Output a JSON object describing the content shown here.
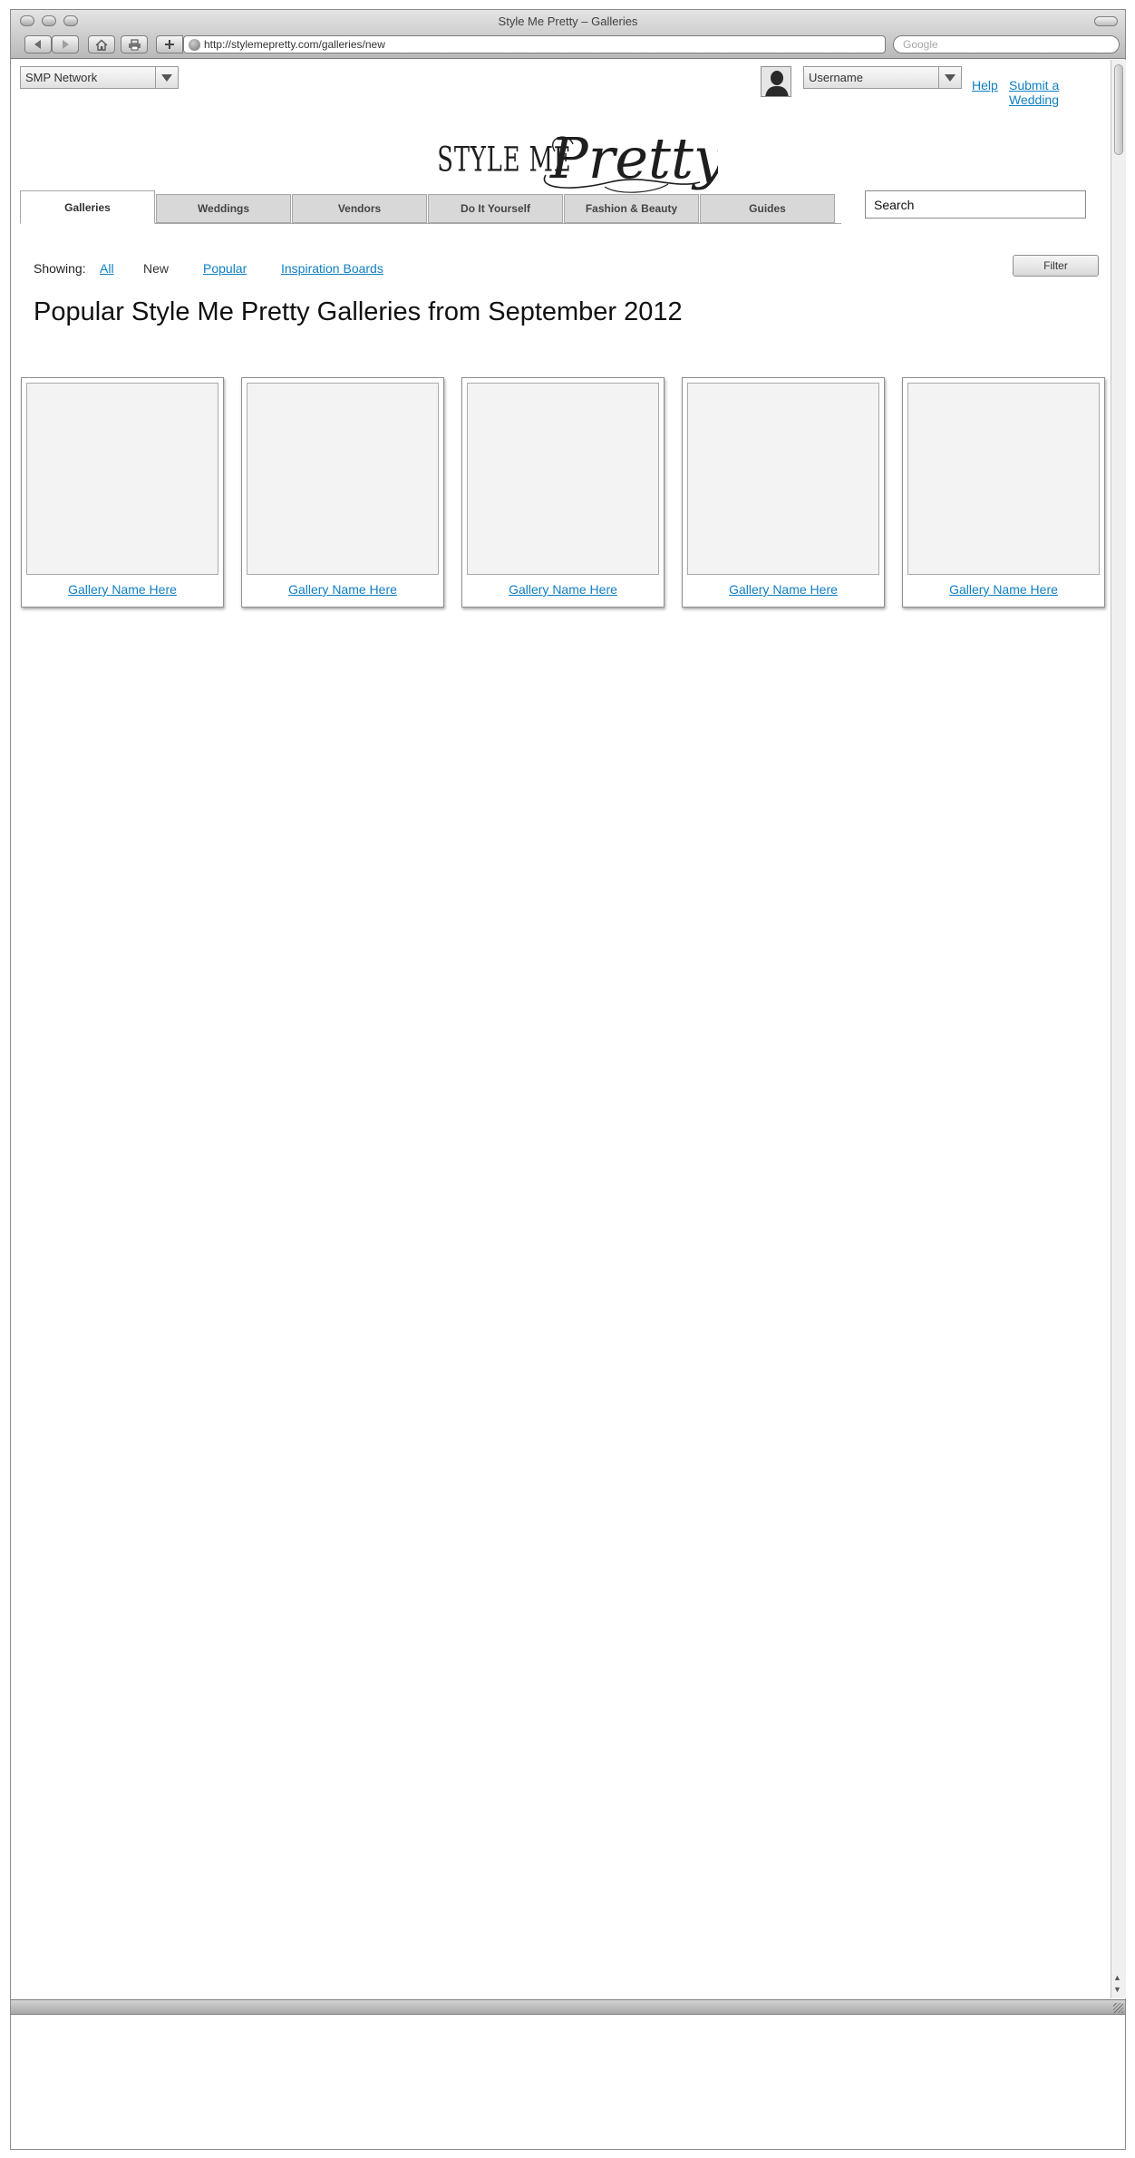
{
  "browser": {
    "window_title": "Style Me Pretty – Galleries",
    "url": "http://stylemepretty.com/galleries/new",
    "search_placeholder": "Google"
  },
  "header": {
    "network_select": "SMP Network",
    "user_select": "Username",
    "help_link": "Help",
    "submit_link": "Submit a Wedding",
    "site_search_value": "Search"
  },
  "nav": {
    "tabs": [
      {
        "label": "Galleries"
      },
      {
        "label": "Weddings"
      },
      {
        "label": "Vendors"
      },
      {
        "label": "Do It Yourself"
      },
      {
        "label": "Fashion & Beauty"
      },
      {
        "label": "Guides"
      }
    ],
    "active_tab": "Galleries"
  },
  "filters": {
    "label": "Showing:",
    "options": [
      {
        "label": "All"
      },
      {
        "label": "New"
      },
      {
        "label": "Popular"
      },
      {
        "label": "Inspiration Boards"
      }
    ],
    "filter_button": "Filter"
  },
  "main": {
    "title": "Popular Style Me Pretty Galleries from September 2012",
    "galleries": [
      {
        "name": "Gallery Name Here"
      },
      {
        "name": "Gallery Name Here"
      },
      {
        "name": "Gallery Name Here"
      },
      {
        "name": "Gallery Name Here"
      },
      {
        "name": "Gallery Name Here"
      }
    ]
  },
  "colors": {
    "link": "#0f7fc2",
    "tab_inactive": "#d8d8d8",
    "thumbnail_placeholder": "#f3f3f3"
  }
}
